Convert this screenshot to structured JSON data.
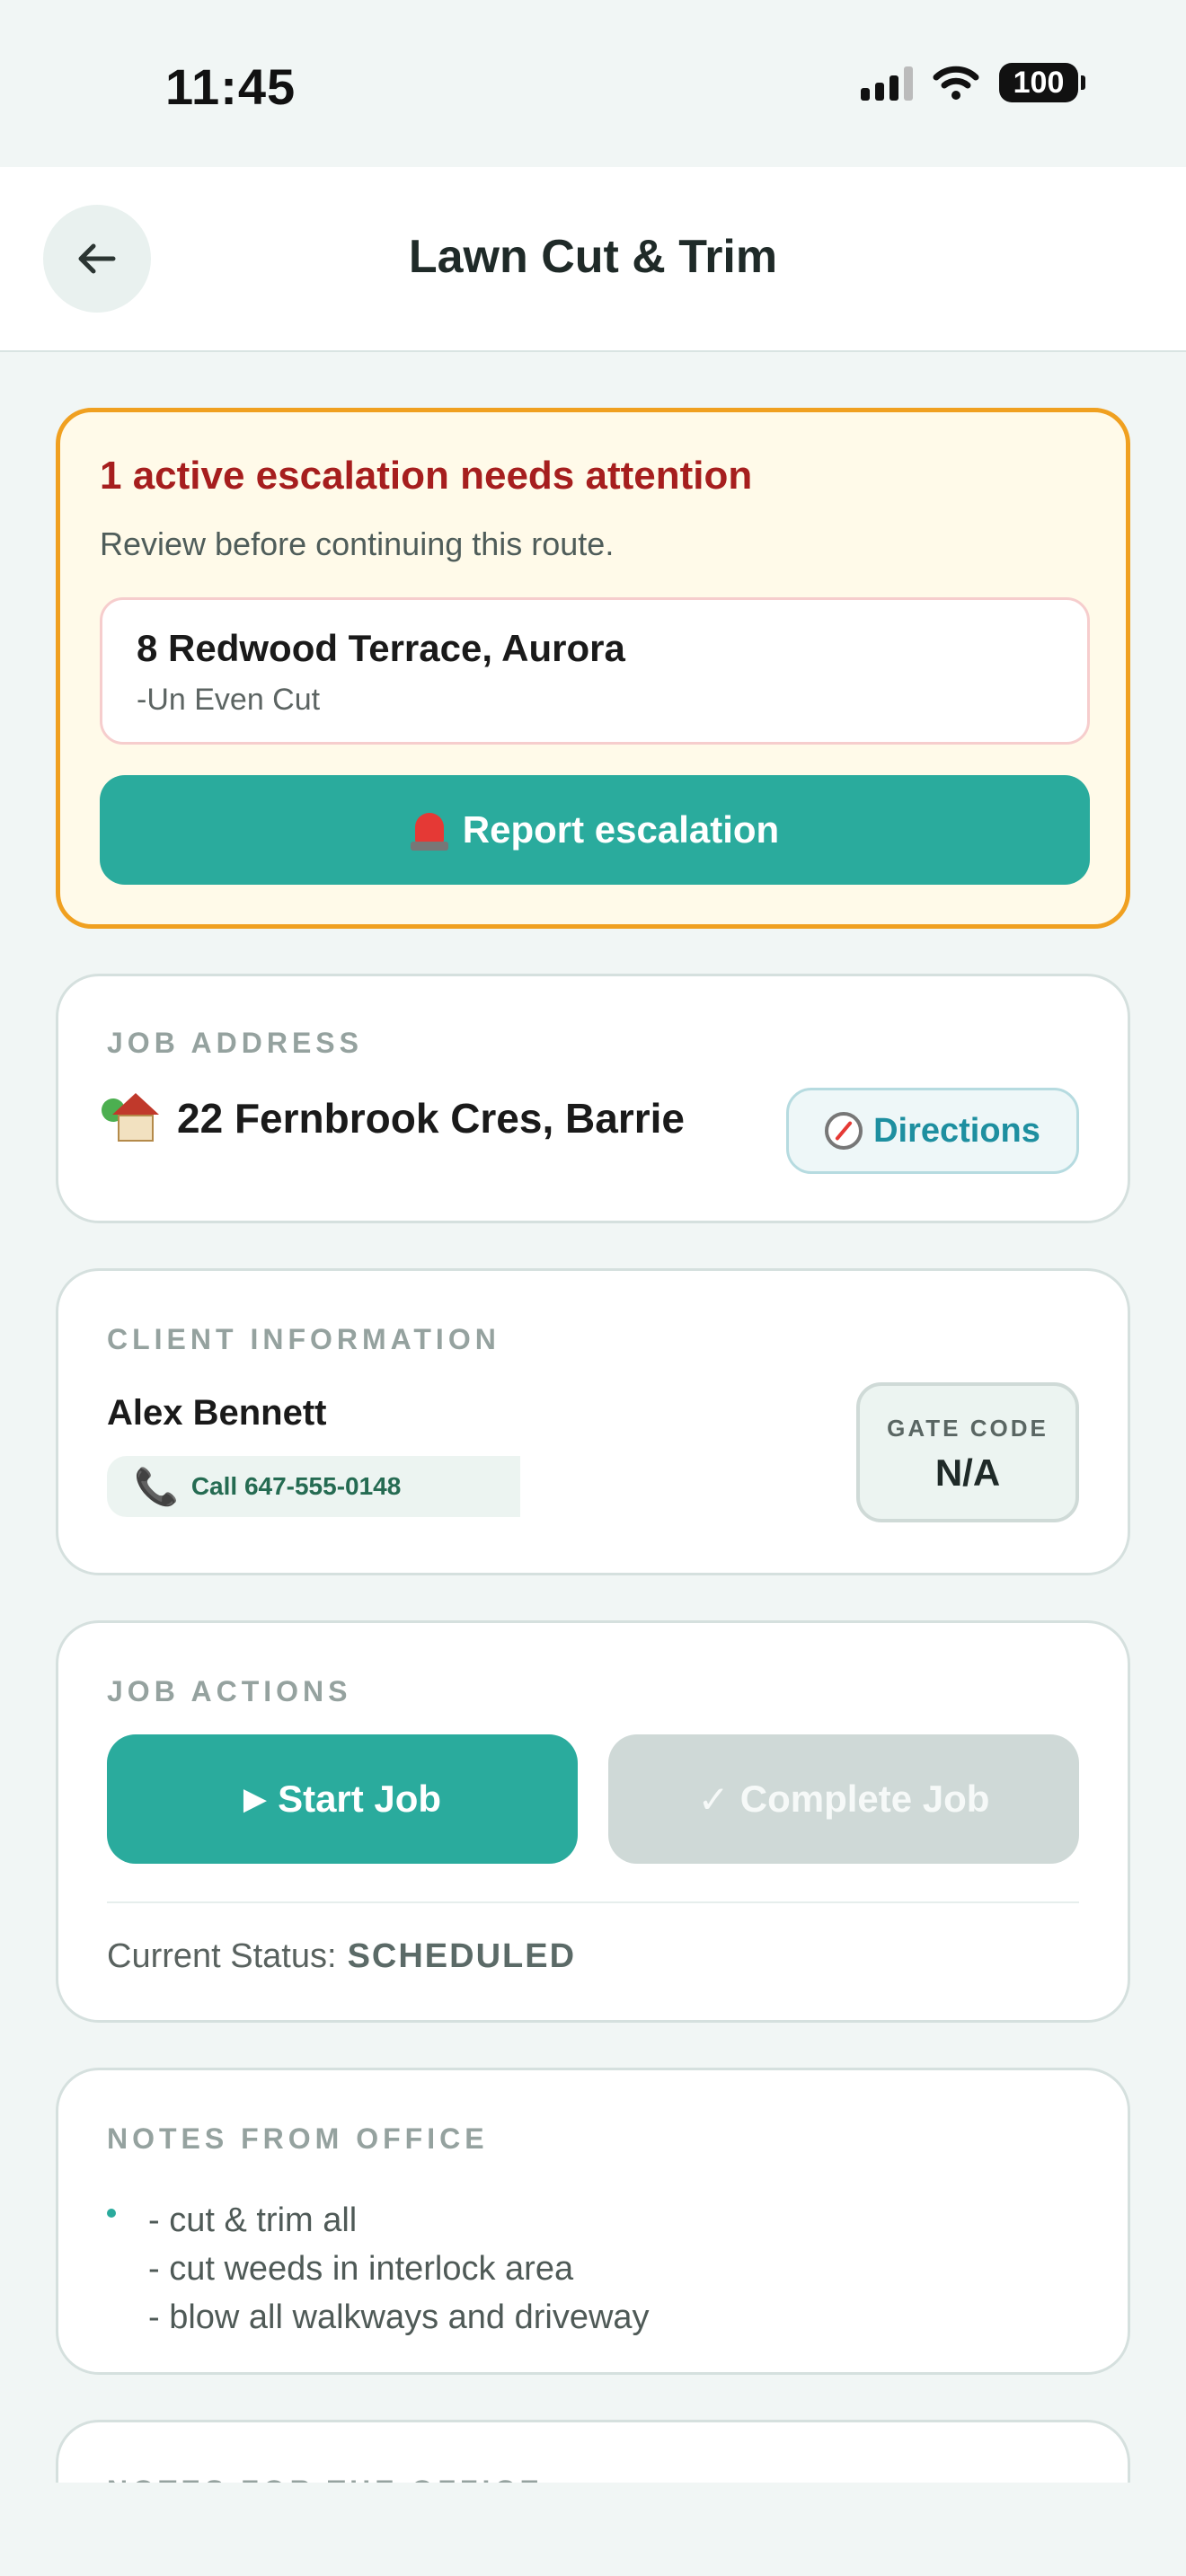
{
  "status_bar": {
    "time": "11:45",
    "battery": "100",
    "icons": [
      "signal-icon",
      "wifi-icon",
      "battery-icon"
    ]
  },
  "header": {
    "title": "Lawn Cut & Trim",
    "back_icon": "arrow-left-icon"
  },
  "escalation": {
    "title": "1 active escalation needs attention",
    "subtitle": "Review before continuing this route.",
    "item": {
      "address": "8 Redwood Terrace, Aurora",
      "issue": "-Un Even Cut"
    },
    "button_label": "Report escalation",
    "button_icon": "siren-icon"
  },
  "job_address": {
    "label": "JOB ADDRESS",
    "address": "22 Fernbrook Cres, Barrie",
    "icon": "house-icon",
    "directions_label": "Directions",
    "directions_icon": "compass-icon"
  },
  "client": {
    "label": "CLIENT INFORMATION",
    "name": "Alex Bennett",
    "call_label": "Call 647-555-0148",
    "call_icon": "phone-icon",
    "gate_code_label": "GATE CODE",
    "gate_code_value": "N/A"
  },
  "actions": {
    "label": "JOB ACTIONS",
    "start_label": "Start Job",
    "start_glyph": "▶",
    "complete_label": "Complete Job",
    "complete_glyph": "✓",
    "status_label": "Current Status:",
    "status_value": "SCHEDULED"
  },
  "notes_from_office": {
    "label": "NOTES FROM OFFICE",
    "lines": [
      "- cut & trim all",
      "- cut weeds in interlock area",
      "- blow all walkways and driveway"
    ]
  },
  "notes_for_office": {
    "label": "NOTES FOR THE OFFICE"
  },
  "colors": {
    "accent": "#2aab9d",
    "escalation_border": "#f0a020",
    "escalation_bg": "#fffae9",
    "escalation_title": "#a61e1e",
    "directions_text": "#1e8fa0",
    "disabled_button": "#cfd9d7"
  }
}
